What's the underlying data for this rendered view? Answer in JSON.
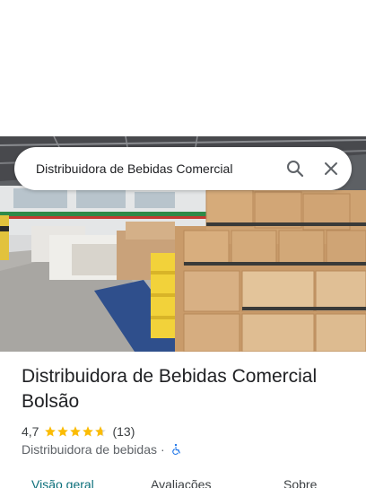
{
  "search": {
    "query": "Distribuidora de Bebidas Comercial"
  },
  "icons": {
    "search": "search-icon",
    "close": "close-icon",
    "star": "star-icon",
    "wheelchair": "wheelchair-accessible-icon"
  },
  "place": {
    "name": "Distribuidora de Bebidas Comercial Bolsão",
    "rating": "4,7",
    "stars_value": 4.7,
    "review_count": "(13)",
    "category": "Distribuidora de bebidas",
    "separator": "·"
  },
  "tabs": [
    {
      "label": "Visão geral",
      "active": true
    },
    {
      "label": "Avaliações",
      "active": false
    },
    {
      "label": "Sobre",
      "active": false
    }
  ],
  "colors": {
    "accent": "#0b6f7a",
    "star": "#fbbc04",
    "wheelchair": "#1a73e8"
  }
}
